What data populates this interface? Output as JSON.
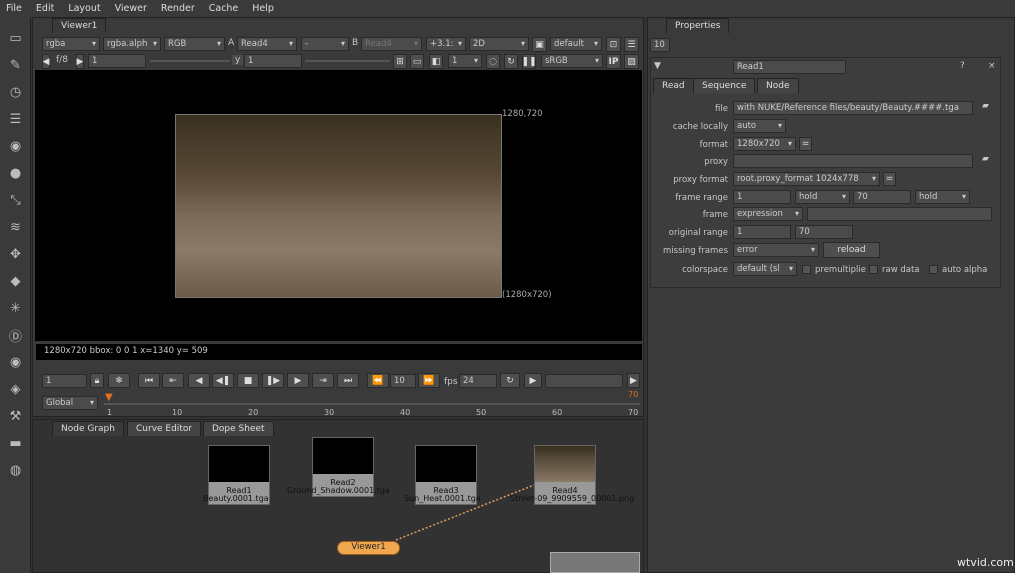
{
  "menu": [
    "File",
    "Edit",
    "Layout",
    "Viewer",
    "Render",
    "Cache",
    "Help"
  ],
  "viewer": {
    "tab": "Viewer1",
    "channels": "rgba",
    "alpha": "rgba.alph",
    "display": "RGB",
    "a_label": "A",
    "a_input": "Read4",
    "op": "-",
    "b_label": "B",
    "b_input": "Read4",
    "gain": "+3.1:",
    "mode": "2D",
    "lut": "default",
    "proxy": "f/8",
    "frame_in": "1",
    "y_label": "y",
    "y_val": "1",
    "downrez": "1",
    "colorspace": "sRGB",
    "ip": "IP",
    "format_label": "1280,720",
    "bbox_label": "(1280x720)",
    "info": "1280x720 bbox: 0 0 1  x=1340 y= 509"
  },
  "playback": {
    "frame": "1",
    "step": "10",
    "fps_label": "fps",
    "fps": "24",
    "range_mode": "Global",
    "ticks": [
      "1",
      "10",
      "20",
      "30",
      "40",
      "50",
      "60",
      "70"
    ],
    "end_marker": "70"
  },
  "properties": {
    "tab": "Properties",
    "max_panels": "10",
    "node_name": "Read1",
    "tabs": [
      "Read",
      "Sequence",
      "Node"
    ],
    "fields": {
      "file_label": "file",
      "file": "with NUKE/Reference files/beauty/Beauty.####.tga",
      "cache_label": "cache locally",
      "cache": "auto",
      "format_label": "format",
      "format": "1280x720",
      "eq": "=",
      "proxy_label": "proxy",
      "proxy": "",
      "proxy_format_label": "proxy format",
      "proxy_format": "root.proxy_format 1024x778",
      "frame_range_label": "frame range",
      "fr_start": "1",
      "fr_before": "hold",
      "fr_end": "70",
      "fr_after": "hold",
      "frame_label": "frame",
      "frame_mode": "expression",
      "orig_range_label": "original range",
      "or_start": "1",
      "or_end": "70",
      "missing_label": "missing frames",
      "missing": "error",
      "reload": "reload",
      "colorspace_label": "colorspace",
      "colorspace": "default (sl",
      "premult": "premultiplie",
      "raw": "raw data",
      "auto_alpha": "auto alpha"
    }
  },
  "nodegraph": {
    "tabs": [
      "Node Graph",
      "Curve Editor",
      "Dope Sheet"
    ],
    "nodes": [
      {
        "name": "Read1",
        "file": "Beauty.0001.tga"
      },
      {
        "name": "Read2",
        "file": "Ground_Shadow.0001.tga"
      },
      {
        "name": "Read3",
        "file": "Sun_Heat.0001.tga"
      },
      {
        "name": "Read4",
        "file": "Street-09_9909559_00001.png"
      }
    ],
    "viewer_node": "Viewer1"
  },
  "watermark": "wtvid.com"
}
